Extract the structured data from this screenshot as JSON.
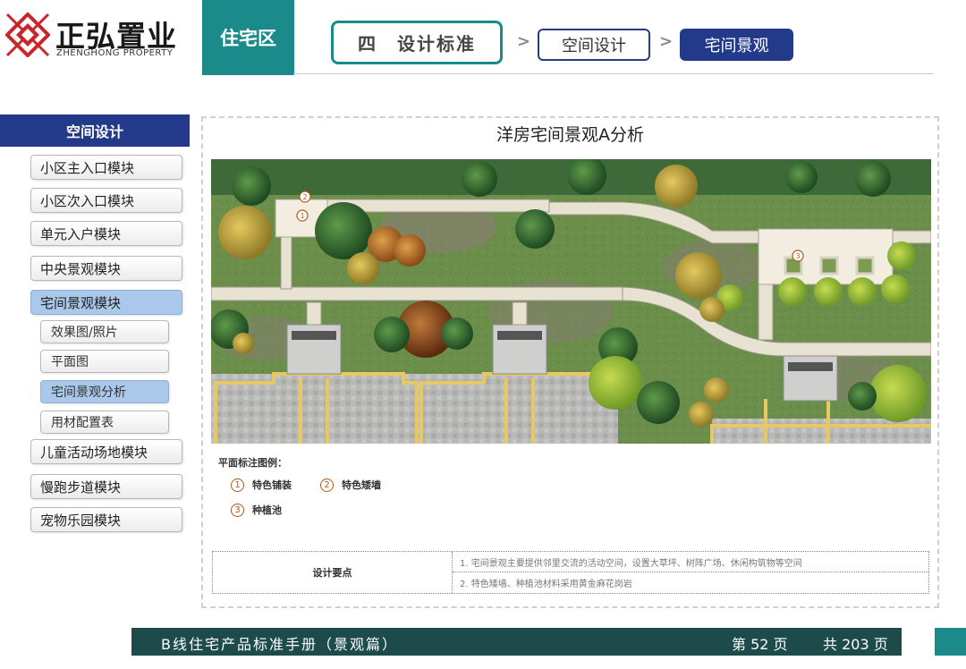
{
  "header": {
    "logo_cn": "正弘置业",
    "logo_en": "ZHENGHONG PROPERTY",
    "section": "住宅区",
    "breadcrumb": [
      "四　设计标准",
      "空间设计",
      "宅间景观"
    ]
  },
  "sidebar": {
    "title": "空间设计",
    "items": [
      {
        "label": "小区主入口模块"
      },
      {
        "label": "小区次入口模块"
      },
      {
        "label": "单元入户模块"
      },
      {
        "label": "中央景观模块"
      },
      {
        "label": "宅间景观模块",
        "active": true
      },
      {
        "label": "儿童活动场地模块"
      },
      {
        "label": "慢跑步道模块"
      },
      {
        "label": "宠物乐园模块"
      }
    ],
    "subitems": [
      {
        "label": "效果图/照片"
      },
      {
        "label": "平面图"
      },
      {
        "label": "宅间景观分析",
        "active": true
      },
      {
        "label": "用材配置表"
      }
    ]
  },
  "main": {
    "title": "洋房宅间景观A分析",
    "legend_title": "平面标注图例：",
    "legend": [
      {
        "num": "1",
        "label": "特色铺装"
      },
      {
        "num": "2",
        "label": "特色矮墙"
      },
      {
        "num": "3",
        "label": "种植池"
      }
    ],
    "key_points_label": "设计要点",
    "key_points": [
      "1. 宅间景观主要提供邻里交流的活动空间，设置大草坪、树阵广场、休闲构筑物等空间",
      "2. 特色矮墙、种植池材料采用黄金麻花岗岩"
    ]
  },
  "footer": {
    "title": "B线住宅产品标准手册（景观篇）",
    "page": "第 52 页",
    "total": "共 203 页"
  },
  "colors": {
    "teal": "#1a8a8a",
    "navy": "#233a8a",
    "active_item": "#a9c8ea",
    "footer": "#1d4a4a",
    "marker": "#b05a1a"
  }
}
